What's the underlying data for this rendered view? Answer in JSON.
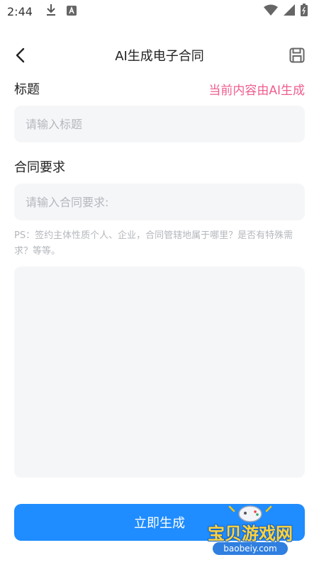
{
  "status_bar": {
    "time": "2:44",
    "left_icons": [
      "download-icon",
      "app-a-icon"
    ],
    "right_icons": [
      "wifi-icon",
      "signal-icon",
      "battery-icon"
    ]
  },
  "header": {
    "title": "AI生成电子合同",
    "back_icon": "chevron-left-icon",
    "save_icon": "save-icon"
  },
  "form": {
    "title_label": "标题",
    "ai_note": "当前内容由AI生成",
    "title_placeholder": "请输入标题",
    "requirement_label": "合同要求",
    "requirement_placeholder": "请输入合同要求:",
    "ps_note": "PS：签约主体性质个人、企业，合同管辖地属于哪里？是否有特殊需求？等等。",
    "content_value": ""
  },
  "actions": {
    "generate_label": "立即生成"
  },
  "watermark": {
    "text": "宝贝游戏网",
    "url": "baobeiy.com"
  },
  "colors": {
    "accent": "#1f8cff",
    "ai_note": "#ef5d8e",
    "input_bg": "#f5f6f8",
    "placeholder": "#b4b7bc"
  }
}
